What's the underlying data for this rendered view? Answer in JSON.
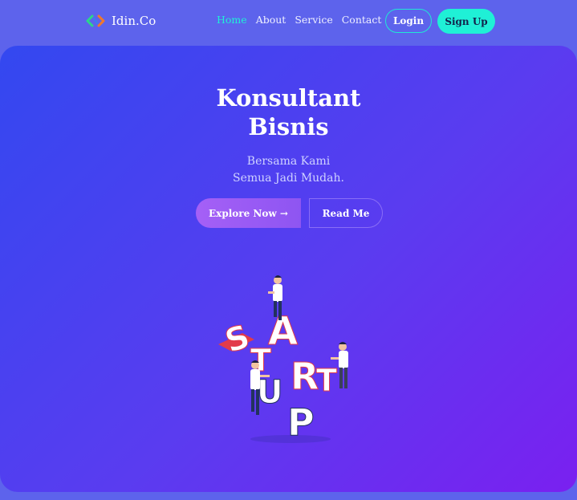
{
  "nav": {
    "brand": "Idin.Co",
    "logo_icon": "code-brackets-icon",
    "links": [
      {
        "label": "Home",
        "active": true
      },
      {
        "label": "About",
        "active": false
      },
      {
        "label": "Service",
        "active": false
      },
      {
        "label": "Contact",
        "active": false
      }
    ],
    "login_label": "Login",
    "signup_label": "Sign Up"
  },
  "hero": {
    "title_line1": "Konsultant",
    "title_line2": "Bisnis",
    "subtitle_line1": "Bersama Kami",
    "subtitle_line2": "Semua Jadi Mudah.",
    "explore_label": "Explore Now →",
    "read_label": "Read Me",
    "illustration": "startup-isometric-illustration",
    "illustration_letters": [
      "S",
      "T",
      "A",
      "R",
      "T",
      "U",
      "P"
    ]
  },
  "colors": {
    "accent": "#1ff0d6",
    "hero_gradient_start": "#3348f0",
    "hero_gradient_end": "#7a20f0",
    "explore_button": "#a560f6"
  }
}
